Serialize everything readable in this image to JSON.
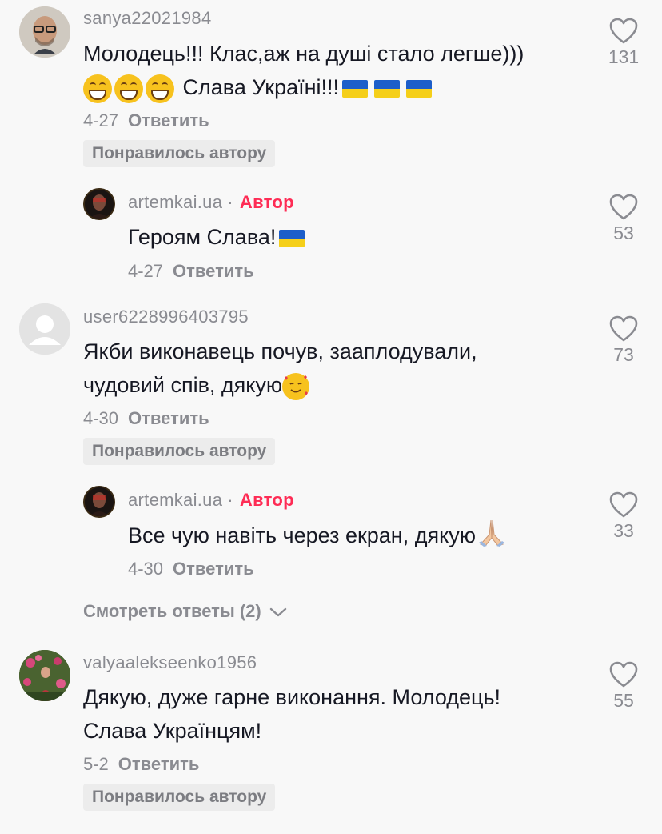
{
  "comments": [
    {
      "username": "sanya22021984",
      "text_line1": "Молодець!!! Клас,аж на душі стало легше)))",
      "text_line2": "Слава Україні!!!",
      "date": "4-27",
      "reply_label": "Ответить",
      "liked_by_creator": "Понравилось автору",
      "likes": "131"
    },
    {
      "username": "artemkai.ua",
      "author_tag": "Автор",
      "text_line1": "Героям Слава!",
      "date": "4-27",
      "reply_label": "Ответить",
      "likes": "53"
    },
    {
      "username": "user6228996403795",
      "text_line1": "Якби виконавець почув, зааплодували,",
      "text_line2": "чудовий спів, дякую",
      "date": "4-30",
      "reply_label": "Ответить",
      "liked_by_creator": "Понравилось автору",
      "likes": "73"
    },
    {
      "username": "artemkai.ua",
      "author_tag": "Автор",
      "text_line1": "Все чую навіть через екран, дякую",
      "date": "4-30",
      "reply_label": "Ответить",
      "likes": "33"
    },
    {
      "username": "valyaalekseenko1956",
      "text_line1": "Дякую, дуже гарне виконання. Молодець!",
      "text_line2": "Слава Українцям!",
      "date": "5-2",
      "reply_label": "Ответить",
      "liked_by_creator": "Понравилось автору",
      "likes": "55"
    }
  ],
  "view_replies": "Смотреть ответы (2)",
  "colors": {
    "author_accent": "#fe2c55",
    "secondary_text": "#8a8b91",
    "background": "#f8f8f8"
  }
}
